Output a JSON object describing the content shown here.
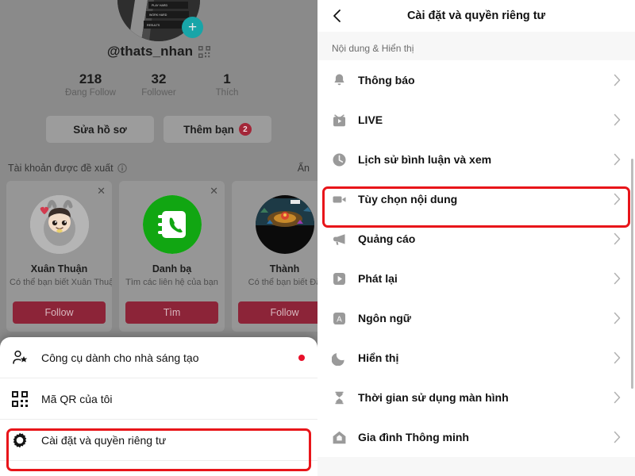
{
  "profile": {
    "avatar_plus_icon": "plus-icon",
    "username": "@thats_nhan",
    "qr_icon": "qr-code-icon",
    "stats": [
      {
        "value": "218",
        "label": "Đang Follow"
      },
      {
        "value": "32",
        "label": "Follower"
      },
      {
        "value": "1",
        "label": "Thích"
      }
    ],
    "actions": [
      {
        "label": "Sửa hồ sơ",
        "badge": ""
      },
      {
        "label": "Thêm bạn",
        "badge": "2"
      }
    ],
    "suggested": {
      "title": "Tài khoản được đề xuất",
      "info_icon": "info-icon",
      "hide_label": "Ẩn",
      "close_icon": "close-icon",
      "cards": [
        {
          "name": "Xuân Thuận",
          "subtitle": "Có thể bạn biết Xuân Thuận",
          "button": "Follow",
          "avatar": "cartoon-bunny-avatar"
        },
        {
          "name": "Danh bạ",
          "subtitle": "Tìm các liên hệ của bạn",
          "button": "Tìm",
          "avatar": "contacts-phone-icon"
        },
        {
          "name": "Thành",
          "subtitle": "Có thể bạn biết Đă",
          "button": "Follow",
          "avatar": "game-screenshot-avatar"
        }
      ]
    }
  },
  "sheet": {
    "items": [
      {
        "label": "Công cụ dành cho nhà sáng tạo",
        "icon": "person-star-icon",
        "dot": true,
        "highlighted": false
      },
      {
        "label": "Mã QR của tôi",
        "icon": "qr-code-icon",
        "dot": false,
        "highlighted": false
      },
      {
        "label": "Cài đặt và quyền riêng tư",
        "icon": "gear-icon",
        "dot": false,
        "highlighted": true
      }
    ]
  },
  "settings": {
    "back_icon": "back-chevron-icon",
    "title": "Cài đặt và quyền riêng tư",
    "section_label": "Nội dung & Hiển thị",
    "chevron_icon": "chevron-right-icon",
    "items": [
      {
        "label": "Thông báo",
        "icon": "bell-icon",
        "highlighted": false
      },
      {
        "label": "LIVE",
        "icon": "live-tv-icon",
        "highlighted": false
      },
      {
        "label": "Lịch sử bình luận và xem",
        "icon": "clock-icon",
        "highlighted": false
      },
      {
        "label": "Tùy chọn nội dung",
        "icon": "video-camera-icon",
        "highlighted": true
      },
      {
        "label": "Quảng cáo",
        "icon": "megaphone-icon",
        "highlighted": false
      },
      {
        "label": "Phát lại",
        "icon": "play-box-icon",
        "highlighted": false
      },
      {
        "label": "Ngôn ngữ",
        "icon": "language-a-icon",
        "highlighted": false
      },
      {
        "label": "Hiển thị",
        "icon": "moon-icon",
        "highlighted": false
      },
      {
        "label": "Thời gian sử dụng màn hình",
        "icon": "hourglass-icon",
        "highlighted": false
      },
      {
        "label": "Gia đình Thông minh",
        "icon": "house-icon",
        "highlighted": false
      }
    ]
  },
  "colors": {
    "highlight_red": "#e8151a",
    "follow_button": "#8c2438",
    "badge_red": "#a32638",
    "plus_teal": "#18a5a8",
    "notification_dot": "#e8102a"
  }
}
